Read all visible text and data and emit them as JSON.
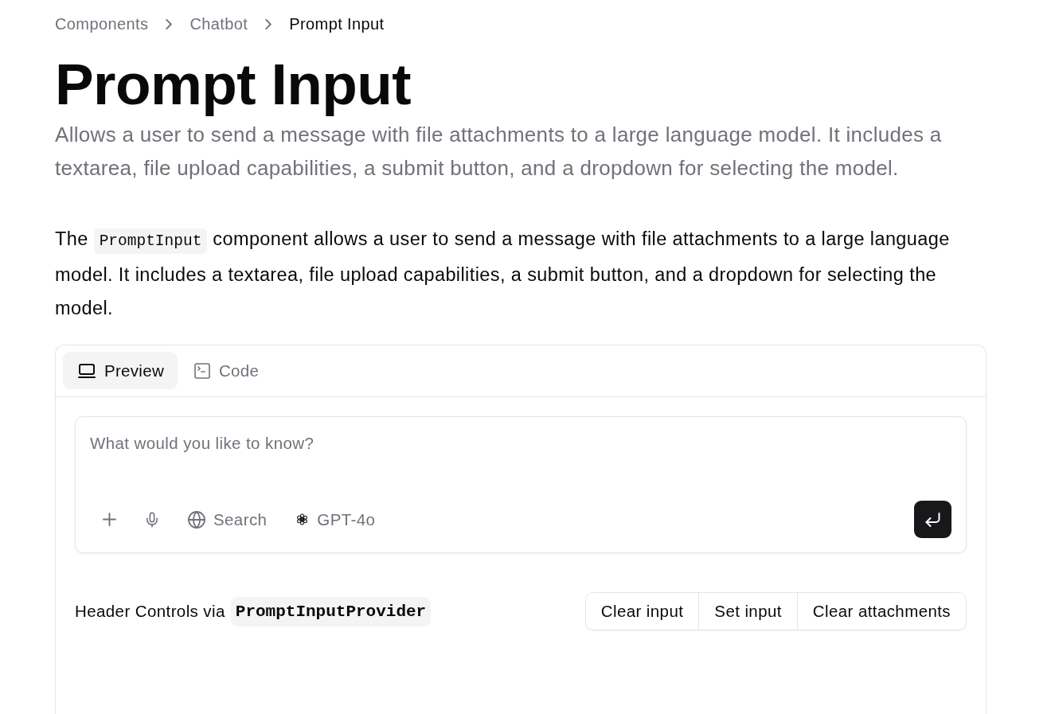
{
  "breadcrumb": [
    {
      "label": "Components",
      "current": false
    },
    {
      "label": "Chatbot",
      "current": false
    },
    {
      "label": "Prompt Input",
      "current": true
    }
  ],
  "page_title": "Prompt Input",
  "description": "Allows a user to send a message with file attachments to a large language model. It includes a textarea, file upload capabilities, a submit button, and a dropdown for selecting the model.",
  "intro": {
    "text_before": "The",
    "code": "PromptInput",
    "text_after": "component allows a user to send a message with file attachments to a large language model. It includes a textarea, file upload capabilities, a submit button, and a dropdown for selecting the model."
  },
  "preview_panel": {
    "tabs": [
      {
        "label": "Preview",
        "selected": true
      },
      {
        "label": "Code",
        "selected": false
      }
    ],
    "prompt_input": {
      "placeholder": "What would you like to know?",
      "search_label": "Search",
      "model": "GPT-4o"
    },
    "header_controls": {
      "label": "Header Controls via",
      "code": "PromptInputProvider",
      "buttons": [
        "Clear input",
        "Set input",
        "Clear attachments"
      ]
    }
  }
}
